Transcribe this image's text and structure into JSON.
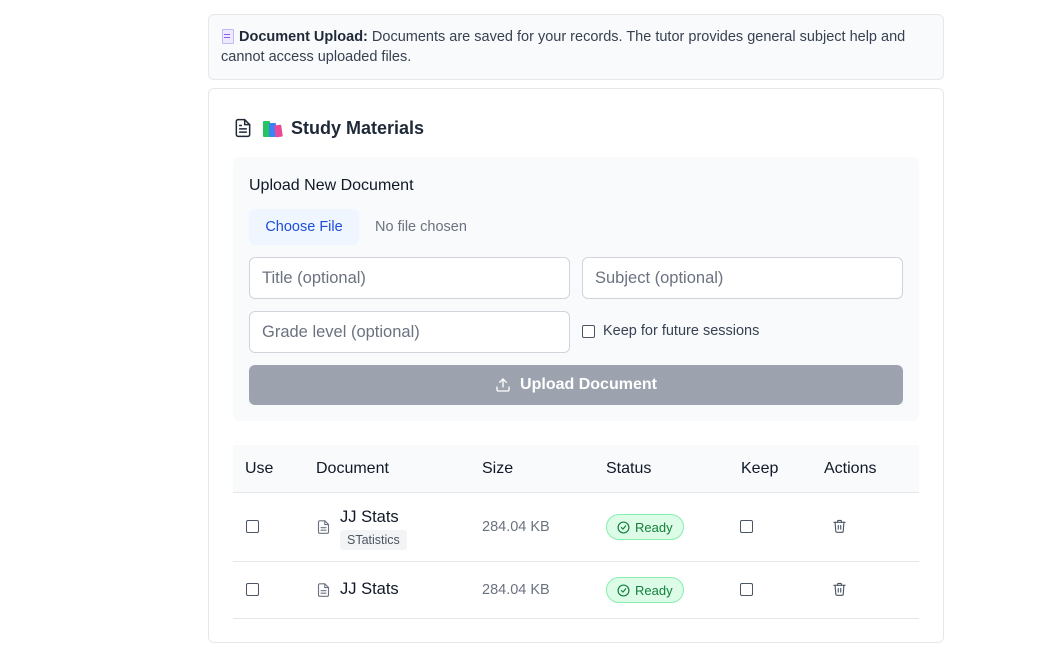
{
  "notice": {
    "label": "Document Upload:",
    "text": "Documents are saved for your records. The tutor provides general subject help and cannot access uploaded files."
  },
  "card": {
    "title": "Study Materials",
    "upload": {
      "heading": "Upload New Document",
      "choose_label": "Choose File",
      "file_status": "No file chosen",
      "title_placeholder": "Title (optional)",
      "subject_placeholder": "Subject (optional)",
      "grade_placeholder": "Grade level (optional)",
      "keep_label": "Keep for future sessions",
      "upload_label": "Upload Document"
    },
    "table": {
      "columns": [
        "Use",
        "Document",
        "Size",
        "Status",
        "Keep",
        "Actions"
      ],
      "rows": [
        {
          "name": "JJ Stats",
          "subject": "STatistics",
          "size": "284.04 KB",
          "status": "Ready"
        },
        {
          "name": "JJ Stats",
          "subject": "",
          "size": "284.04 KB",
          "status": "Ready"
        }
      ]
    }
  },
  "colors": {
    "ready_bg": "#dcfce7",
    "ready_text": "#15803d",
    "upload_button": "#9ca3af",
    "choose_button_text": "#1d4ed8"
  }
}
